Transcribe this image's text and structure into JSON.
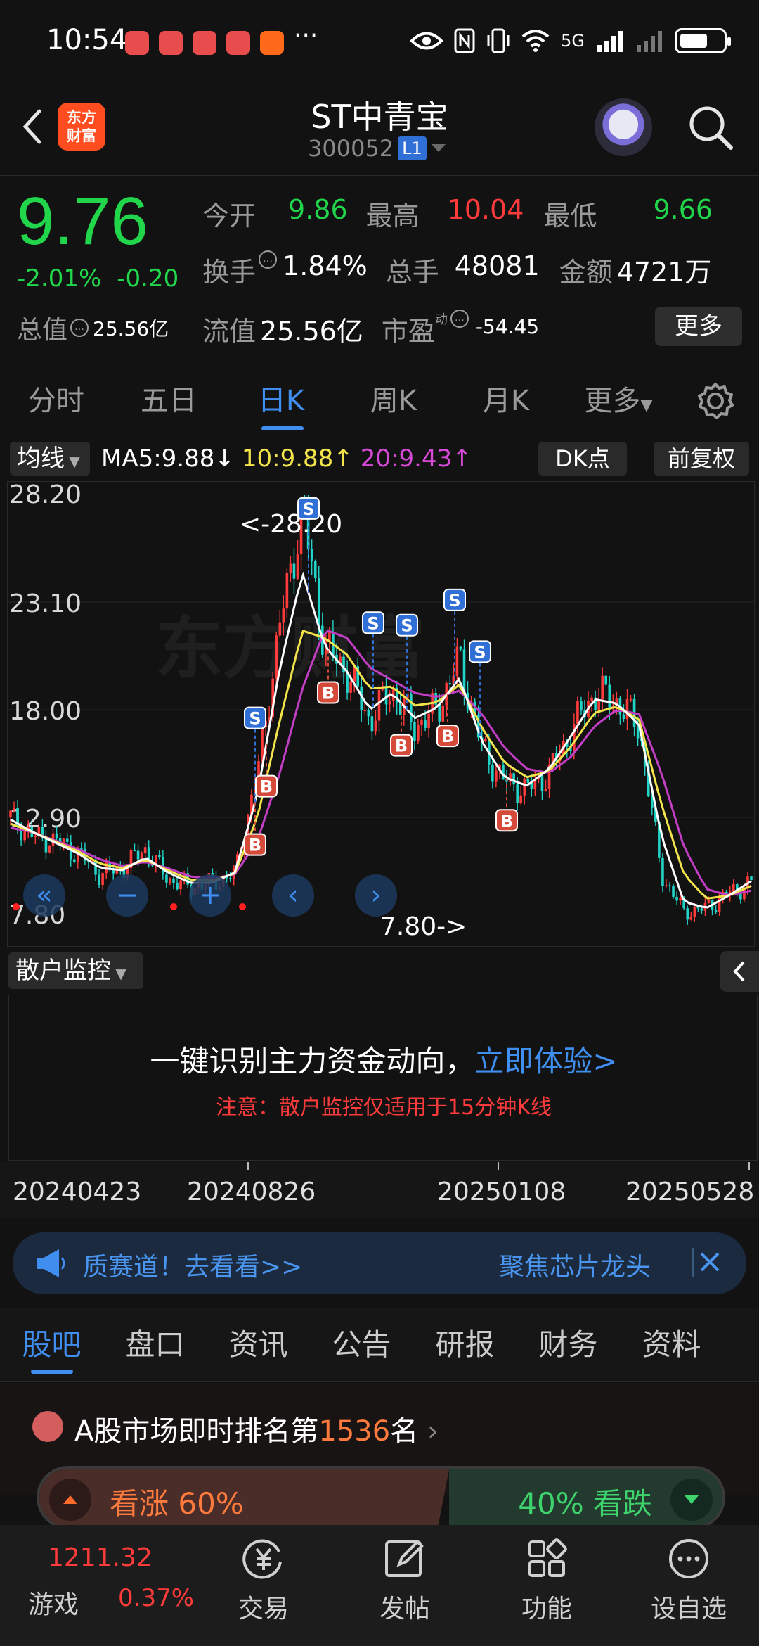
{
  "status_bar": {
    "time": "10:54",
    "network": "5G"
  },
  "header": {
    "stock_name": "ST中青宝",
    "stock_code": "300052",
    "level_badge": "L1",
    "logo_line1": "东方",
    "logo_line2": "财富"
  },
  "quote": {
    "price": "9.76",
    "change_pct": "-2.01%",
    "change": "-0.20",
    "open_label": "今开",
    "open": "9.86",
    "high_label": "最高",
    "high": "10.04",
    "low_label": "最低",
    "low": "9.66",
    "turnover_label": "换手",
    "turnover": "1.84%",
    "volume_label": "总手",
    "volume": "48081",
    "amount_label": "金额",
    "amount": "4721万",
    "mcap_label": "总值",
    "mcap": "25.56亿",
    "float_label": "流值",
    "float": "25.56亿",
    "pe_label": "市盈",
    "pe_sup": "动",
    "pe": "-54.45",
    "more_label": "更多"
  },
  "period_tabs": [
    "分时",
    "五日",
    "日K",
    "周K",
    "月K",
    "更多"
  ],
  "chart_bar": {
    "ma_button": "均线",
    "ma5": "MA5:9.88↓",
    "ma10": "10:9.88↑",
    "ma20": "20:9.43↑",
    "dk_button": "DK点",
    "fq_button": "前复权"
  },
  "chart_data": {
    "type": "candlestick",
    "y_ticks": [
      "28.20",
      "23.10",
      "18.00",
      "12.90",
      "7.80"
    ],
    "max_label": "<-28.20",
    "min_label": "7.80->",
    "watermark": "东方财富",
    "x": [
      "20240423",
      "20240826",
      "20250108",
      "20250528"
    ],
    "close_trend": [
      12.9,
      12.0,
      11.8,
      11.2,
      10.2,
      10.5,
      11.4,
      10.0,
      9.6,
      9.8,
      10.2,
      15.0,
      22.0,
      27.5,
      21.0,
      19.8,
      17.5,
      19.0,
      17.2,
      18.0,
      20.4,
      16.2,
      14.6,
      14.2,
      15.0,
      17.0,
      18.8,
      18.4,
      17.2,
      10.2,
      8.4,
      8.6,
      9.3,
      9.8
    ],
    "ma5": [
      12.8,
      12.2,
      11.7,
      11.2,
      10.5,
      10.4,
      11.0,
      10.3,
      9.8,
      9.8,
      10.3,
      14.0,
      20.0,
      24.5,
      21.0,
      19.8,
      18.0,
      18.8,
      17.6,
      18.1,
      19.5,
      16.5,
      14.8,
      14.4,
      15.2,
      16.8,
      18.5,
      18.3,
      17.3,
      12.0,
      8.9,
      8.6,
      9.2,
      9.88
    ],
    "ma20": [
      12.4,
      12.2,
      11.8,
      11.4,
      10.9,
      10.6,
      10.8,
      10.5,
      10.1,
      10.0,
      10.2,
      11.8,
      15.0,
      19.0,
      21.8,
      21.4,
      20.0,
      19.4,
      18.8,
      18.6,
      18.9,
      17.8,
      16.2,
      15.2,
      15.0,
      15.8,
      17.2,
      18.0,
      17.8,
      15.0,
      11.5,
      9.5,
      9.2,
      9.43
    ],
    "signals": [
      "S",
      "B",
      "B",
      "S",
      "B",
      "S",
      "S",
      "B",
      "S",
      "B",
      "S",
      "B"
    ]
  },
  "monitor": {
    "title": "散户监控",
    "main_text": "一键识别主力资金动向，",
    "link_text": "立即体验>",
    "note": "注意：散户监控仅适用于15分钟K线"
  },
  "banner": {
    "left": "质赛道！去看看>>",
    "right": "聚焦芯片龙头"
  },
  "bottom_tabs": [
    "股吧",
    "盘口",
    "资讯",
    "公告",
    "研报",
    "财务",
    "资料"
  ],
  "rank": {
    "prefix": "A股市场即时排名第",
    "number": "1536",
    "suffix": "名"
  },
  "vote": {
    "up_label": "看涨 60%",
    "down_label": "40% 看跌",
    "up_pct": 60
  },
  "nav": {
    "index_value": "1211.32",
    "index_name": "游戏",
    "index_pct": "0.37%",
    "items": [
      "交易",
      "发帖",
      "功能",
      "设自选"
    ]
  },
  "colors": {
    "up": "#ff3b3b",
    "down": "#22d64b",
    "accent": "#3f8ef0"
  }
}
